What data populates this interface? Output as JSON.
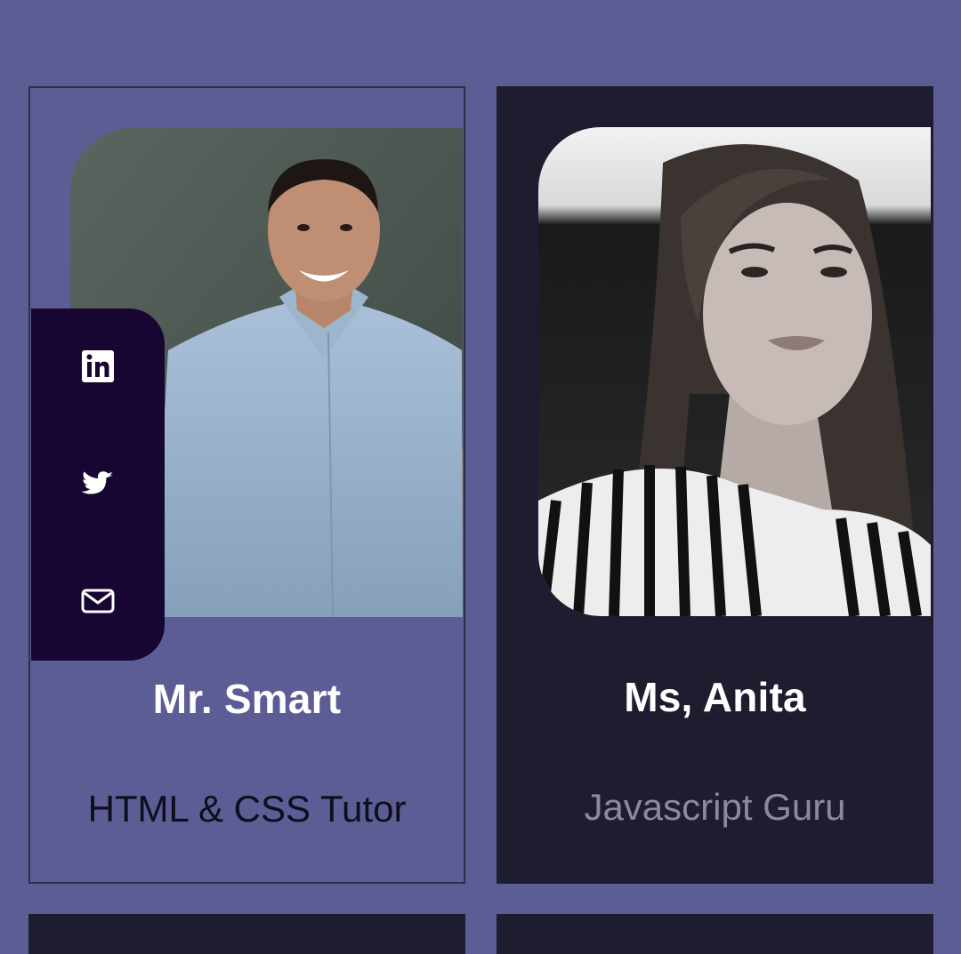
{
  "colors": {
    "page_background": "#5d5d96",
    "card_dark": "#1e1c2f",
    "social_panel": "#160631"
  },
  "cards": [
    {
      "name": "Mr. Smart",
      "role": "HTML & CSS Tutor",
      "social_icons": [
        "linkedin-icon",
        "twitter-icon",
        "mail-icon"
      ]
    },
    {
      "name": "Ms, Anita",
      "role": "Javascript Guru"
    }
  ]
}
